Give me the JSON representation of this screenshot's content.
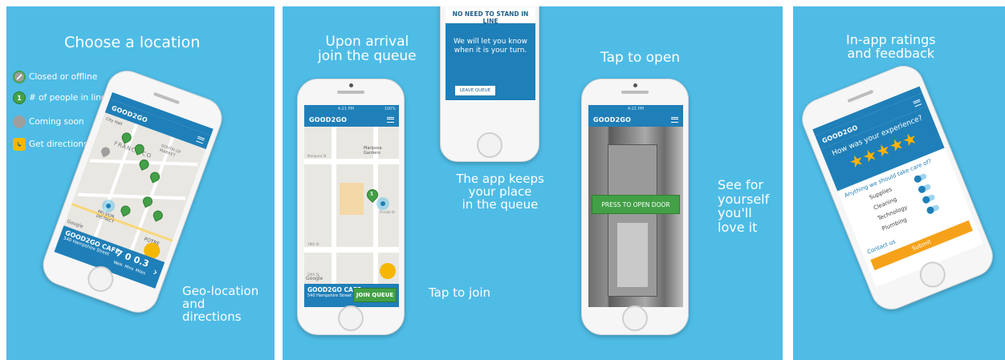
{
  "panel1": {
    "title": "Choose a location",
    "legend": [
      {
        "label": "Closed or offline",
        "icon": "closed-icon"
      },
      {
        "label": "# of people in line",
        "icon": "green-pin-icon",
        "number": "1"
      },
      {
        "label": "Coming soon",
        "icon": "gray-pin-icon"
      },
      {
        "label": "Get directions",
        "icon": "directions-icon"
      }
    ],
    "logo": "GOOD2GO",
    "map_labels": [
      "City Hall",
      "FRANCISCO",
      "SOUTH OF MARKET",
      "MISSION DISTRICT",
      "POTRE",
      "Google"
    ],
    "venue_name": "GOOD2GO CAFE",
    "venue_address": "540 Hampshire Street",
    "walk_value": "7",
    "walk_label": "Walk",
    "mins_value": "0",
    "mins_label": "Mins",
    "miles_value": "0.3",
    "miles_label": "Miles",
    "caption": [
      "Geo-location",
      "and",
      "directions"
    ]
  },
  "panel2": {
    "title": [
      "Upon arrival",
      "join the queue"
    ],
    "time": "4:21 PM",
    "battery": "100%",
    "logo": "GOOD2GO",
    "map_label": "Mariposa Gardens",
    "street_labels": [
      "Mariposa St",
      "Florida St",
      "18th St",
      "19th St"
    ],
    "google": "Google",
    "venue_name": "GOOD2GO CAFE",
    "venue_address": "540 Hampshire Street",
    "join_button": "JOIN QUEUE",
    "tap_caption": "Tap to join",
    "popup_header": "NO NEED TO STAND IN LINE",
    "popup_body": [
      "We will let you know",
      "when it is your turn."
    ],
    "leave_button": "LEAVE QUEUE",
    "keeps_caption": [
      "The app keeps",
      "your place",
      "in the queue"
    ],
    "open_title": "Tap to open",
    "open_time": "4:21 PM",
    "open_logo": "GOOD2GO",
    "open_button": "PRESS TO OPEN DOOR",
    "see_caption": [
      "See for",
      "yourself",
      "you'll",
      "love it"
    ]
  },
  "panel3": {
    "title": [
      "In-app ratings",
      "and feedback"
    ],
    "logo": "GOOD2GO",
    "question": "How was your experience?",
    "stars": 5,
    "care_title": "Anything we should take care of?",
    "care_items": [
      "Supplies",
      "Cleaning",
      "Technology",
      "Plumbing"
    ],
    "contact": "Contact us",
    "submit": "Submit"
  }
}
